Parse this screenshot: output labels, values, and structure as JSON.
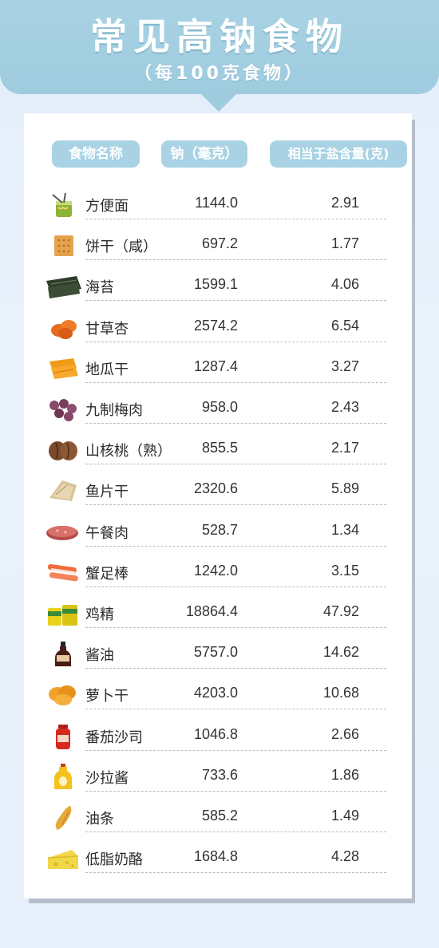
{
  "header": {
    "title": "常见高钠食物",
    "subtitle": "（每100克食物）"
  },
  "table": {
    "columns": [
      "食物名称",
      "钠（毫克）",
      "相当于盐含量(克)"
    ],
    "rows": [
      {
        "icon": "instant-noodle-icon",
        "name": "方便面",
        "sodium": "1144.0",
        "salt": "2.91"
      },
      {
        "icon": "cracker-icon",
        "name": "饼干（咸）",
        "sodium": "697.2",
        "salt": "1.77"
      },
      {
        "icon": "seaweed-icon",
        "name": "海苔",
        "sodium": "1599.1",
        "salt": "4.06"
      },
      {
        "icon": "dried-apricot-icon",
        "name": "甘草杏",
        "sodium": "2574.2",
        "salt": "6.54"
      },
      {
        "icon": "dried-sweet-potato-icon",
        "name": "地瓜干",
        "sodium": "1287.4",
        "salt": "3.27"
      },
      {
        "icon": "preserved-plum-icon",
        "name": "九制梅肉",
        "sodium": "958.0",
        "salt": "2.43"
      },
      {
        "icon": "hickory-nut-icon",
        "name": "山核桃（熟）",
        "sodium": "855.5",
        "salt": "2.17"
      },
      {
        "icon": "dried-fish-slice-icon",
        "name": "鱼片干",
        "sodium": "2320.6",
        "salt": "5.89"
      },
      {
        "icon": "luncheon-meat-icon",
        "name": "午餐肉",
        "sodium": "528.7",
        "salt": "1.34"
      },
      {
        "icon": "crab-stick-icon",
        "name": "蟹足棒",
        "sodium": "1242.0",
        "salt": "3.15"
      },
      {
        "icon": "chicken-essence-icon",
        "name": "鸡精",
        "sodium": "18864.4",
        "salt": "47.92"
      },
      {
        "icon": "soy-sauce-icon",
        "name": "酱油",
        "sodium": "5757.0",
        "salt": "14.62"
      },
      {
        "icon": "dried-radish-icon",
        "name": "萝卜干",
        "sodium": "4203.0",
        "salt": "10.68"
      },
      {
        "icon": "ketchup-icon",
        "name": "番茄沙司",
        "sodium": "1046.8",
        "salt": "2.66"
      },
      {
        "icon": "salad-dressing-icon",
        "name": "沙拉酱",
        "sodium": "733.6",
        "salt": "1.86"
      },
      {
        "icon": "fried-dough-stick-icon",
        "name": "油条",
        "sodium": "585.2",
        "salt": "1.49"
      },
      {
        "icon": "cheese-icon",
        "name": "低脂奶酪",
        "sodium": "1684.8",
        "salt": "4.28"
      }
    ]
  },
  "colors": {
    "accent": "#a9d3e4",
    "background": "#e3eefa",
    "text": "#2b2b2b"
  }
}
